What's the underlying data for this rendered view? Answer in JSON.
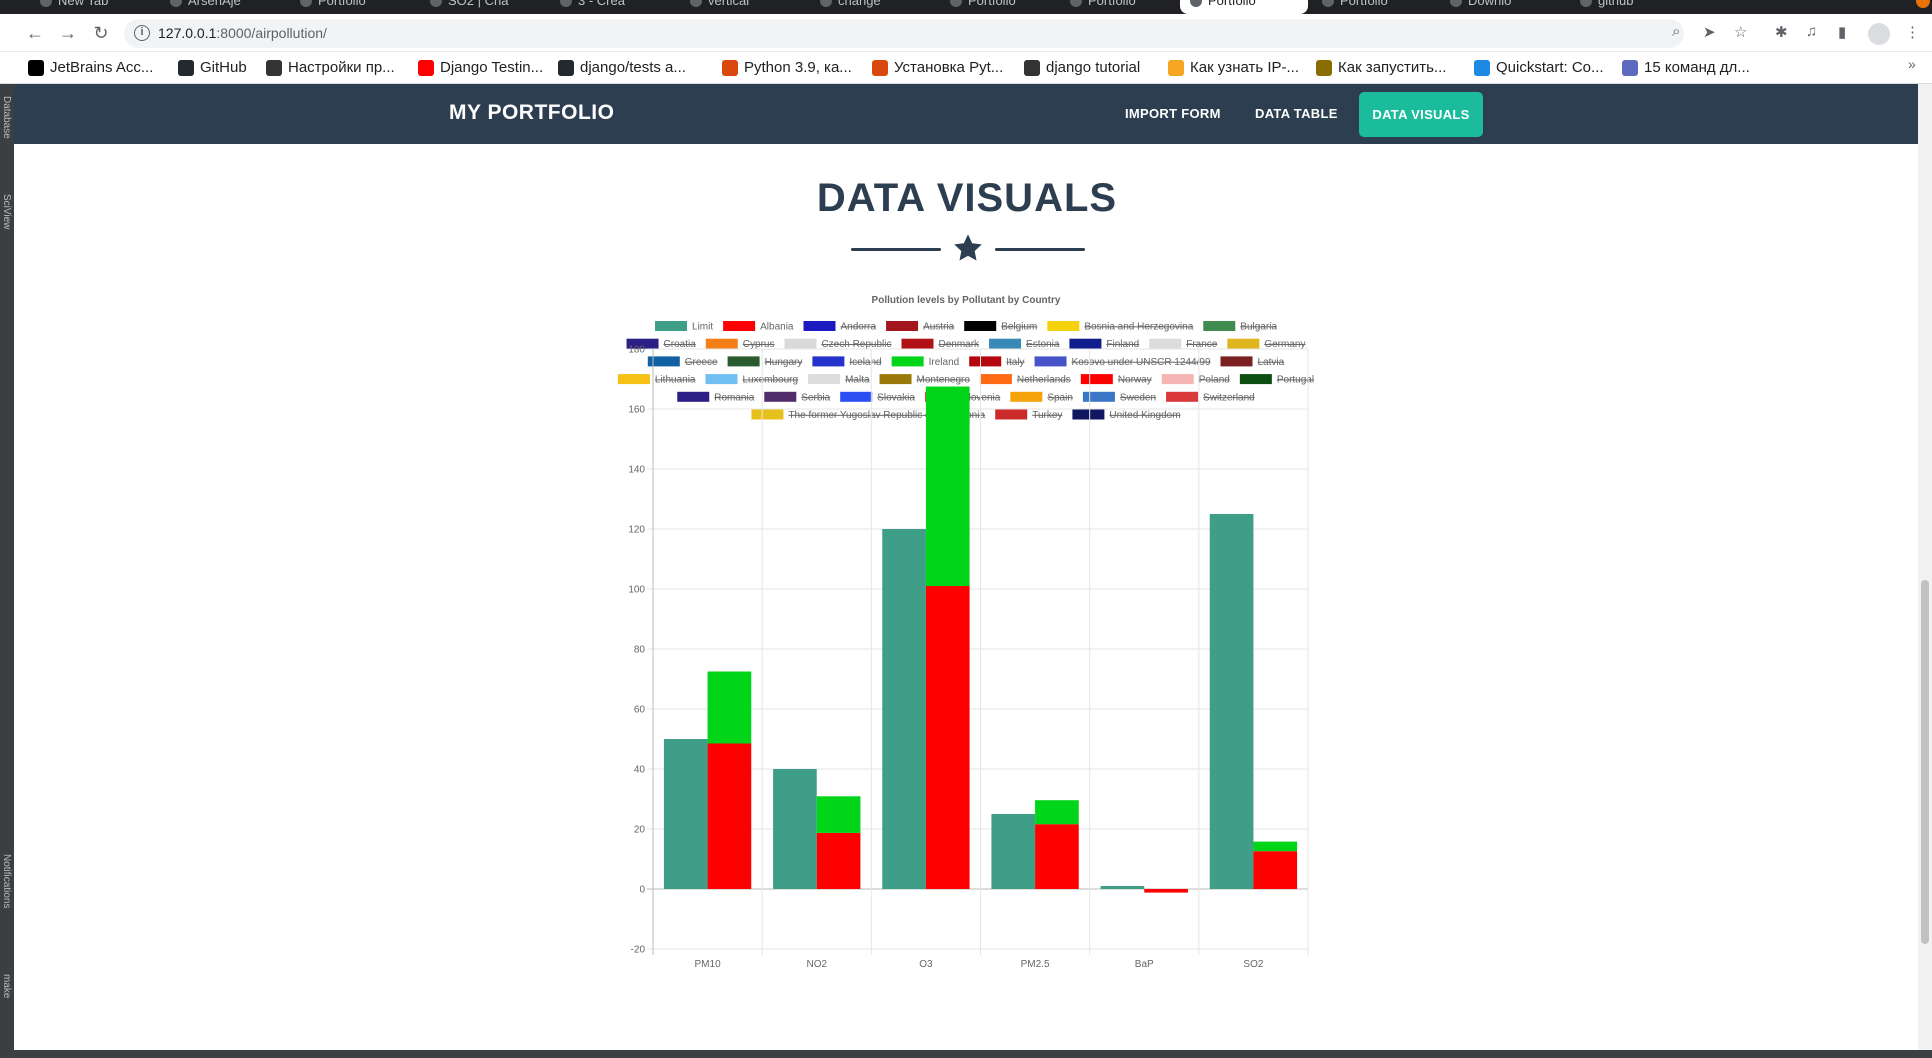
{
  "browser": {
    "tabs": [
      {
        "label": "New Tab",
        "x": 30,
        "w": 118
      },
      {
        "label": "ArsenAje",
        "x": 160,
        "w": 118
      },
      {
        "label": "Portfolio",
        "x": 290,
        "w": 118
      },
      {
        "label": "SO2 | Cha",
        "x": 420,
        "w": 118
      },
      {
        "label": "3 - Crea",
        "x": 550,
        "w": 118
      },
      {
        "label": "vertical",
        "x": 680,
        "w": 118
      },
      {
        "label": "change",
        "x": 810,
        "w": 118
      },
      {
        "label": "Portfolio",
        "x": 940,
        "w": 118
      },
      {
        "label": "Portfolio",
        "x": 1060,
        "w": 118
      },
      {
        "label": "Portfolio",
        "x": 1180,
        "w": 128,
        "active": true
      },
      {
        "label": "Portfolio",
        "x": 1312,
        "w": 118
      },
      {
        "label": "Downlo",
        "x": 1440,
        "w": 118
      },
      {
        "label": "github",
        "x": 1570,
        "w": 110
      }
    ],
    "url_host": "127.0.0.1",
    "url_rest": ":8000/airpollution/",
    "bookmarks": [
      {
        "label": "JetBrains Acc...",
        "color": "#000000"
      },
      {
        "label": "GitHub",
        "color": "#24292e"
      },
      {
        "label": "Настройки пр...",
        "color": "#333333"
      },
      {
        "label": "Django Testin...",
        "color": "#ff0000"
      },
      {
        "label": "django/tests a...",
        "color": "#24292e"
      },
      {
        "label": "Python 3.9, ка...",
        "color": "#d9480f"
      },
      {
        "label": "Установка Pyt...",
        "color": "#d9480f"
      },
      {
        "label": "django tutorial",
        "color": "#333333"
      },
      {
        "label": "Как узнать IP-...",
        "color": "#f5a623"
      },
      {
        "label": "Как запустить...",
        "color": "#8a6d00"
      },
      {
        "label": "Quickstart: Co...",
        "color": "#1e88e5"
      },
      {
        "label": "15 команд дл...",
        "color": "#5c6bc0"
      }
    ]
  },
  "ide": {
    "labels": [
      "Database",
      "SciView",
      "Notifications",
      "make"
    ]
  },
  "nav": {
    "brand": "MY PORTFOLIO",
    "import": "IMPORT FORM",
    "table": "DATA TABLE",
    "visuals": "DATA VISUALS"
  },
  "page": {
    "title": "DATA VISUALS"
  },
  "chart_data": {
    "type": "bar",
    "title": "Pollution levels by Pollutant by Country",
    "categories": [
      "PM10",
      "NO2",
      "O3",
      "PM2.5",
      "BaP",
      "SO2"
    ],
    "ylim": [
      -20,
      180
    ],
    "yticks": [
      -20,
      0,
      20,
      40,
      60,
      80,
      100,
      120,
      140,
      160,
      180
    ],
    "grid": true,
    "legend_position": "top",
    "stacked_countries": true,
    "series": [
      {
        "name": "Limit",
        "color": "#3e9e87",
        "hidden": false,
        "stack": "limit",
        "values": [
          50,
          40,
          120,
          25,
          1,
          125
        ]
      },
      {
        "name": "Albania",
        "color": "#ff0000",
        "hidden": false,
        "stack": "countries",
        "values": [
          48.5,
          18.7,
          101,
          21.6,
          -1.2,
          12.6
        ]
      },
      {
        "name": "Andorra",
        "color": "#1c1bbf",
        "hidden": true
      },
      {
        "name": "Austria",
        "color": "#a4161e",
        "hidden": true
      },
      {
        "name": "Belgium",
        "color": "#000000",
        "hidden": true
      },
      {
        "name": "Bosnia and Herzegovina",
        "color": "#f5d10a",
        "hidden": true
      },
      {
        "name": "Bulgaria",
        "color": "#3f8c4e",
        "hidden": true
      },
      {
        "name": "Croatia",
        "color": "#2b1e85",
        "hidden": true
      },
      {
        "name": "Cyprus",
        "color": "#f57f17",
        "hidden": true
      },
      {
        "name": "Czech Republic",
        "color": "#d9d9d9",
        "hidden": true
      },
      {
        "name": "Denmark",
        "color": "#b01016",
        "hidden": true
      },
      {
        "name": "Estonia",
        "color": "#3889b6",
        "hidden": true
      },
      {
        "name": "Finland",
        "color": "#0f1e8c",
        "hidden": true
      },
      {
        "name": "France",
        "color": "#dcdcdc",
        "hidden": true
      },
      {
        "name": "Germany",
        "color": "#e0b61f",
        "hidden": true
      },
      {
        "name": "Greece",
        "color": "#1160a2",
        "hidden": true
      },
      {
        "name": "Hungary",
        "color": "#2a5b2e",
        "hidden": true
      },
      {
        "name": "Iceland",
        "color": "#2433c9",
        "hidden": true
      },
      {
        "name": "Ireland",
        "color": "#00d51a",
        "hidden": false,
        "stack": "countries",
        "values": [
          24,
          12.2,
          66.5,
          8,
          0,
          3.2
        ]
      },
      {
        "name": "Italy",
        "color": "#b5050d",
        "hidden": true
      },
      {
        "name": "Kosovo under UNSCR 1244/99",
        "color": "#4653c9",
        "hidden": true
      },
      {
        "name": "Latvia",
        "color": "#7a2020",
        "hidden": true
      },
      {
        "name": "Lithuania",
        "color": "#f6c015",
        "hidden": true
      },
      {
        "name": "Luxembourg",
        "color": "#70bff0",
        "hidden": true
      },
      {
        "name": "Malta",
        "color": "#dcdcdc",
        "hidden": true
      },
      {
        "name": "Montenegro",
        "color": "#9c7a09",
        "hidden": true
      },
      {
        "name": "Netherlands",
        "color": "#ff6a14",
        "hidden": true
      },
      {
        "name": "Norway",
        "color": "#ff0000",
        "hidden": true
      },
      {
        "name": "Poland",
        "color": "#f6b5b5",
        "hidden": true
      },
      {
        "name": "Portugal",
        "color": "#0c4d11",
        "hidden": true
      },
      {
        "name": "Romania",
        "color": "#2b1e85",
        "hidden": true
      },
      {
        "name": "Serbia",
        "color": "#512d6b",
        "hidden": true
      },
      {
        "name": "Slovakia",
        "color": "#2b4ef2",
        "hidden": true
      },
      {
        "name": "Slovenia",
        "color": "#f93b3b",
        "hidden": true
      },
      {
        "name": "Spain",
        "color": "#f6a20a",
        "hidden": true
      },
      {
        "name": "Sweden",
        "color": "#3b76c9",
        "hidden": true
      },
      {
        "name": "Switzerland",
        "color": "#d9393b",
        "hidden": true
      },
      {
        "name": "The former Yugoslav Republic of Macedonia",
        "color": "#e6c11b",
        "hidden": true
      },
      {
        "name": "Turkey",
        "color": "#cc2a2a",
        "hidden": true
      },
      {
        "name": "United Kingdom",
        "color": "#101761",
        "hidden": true
      }
    ]
  }
}
